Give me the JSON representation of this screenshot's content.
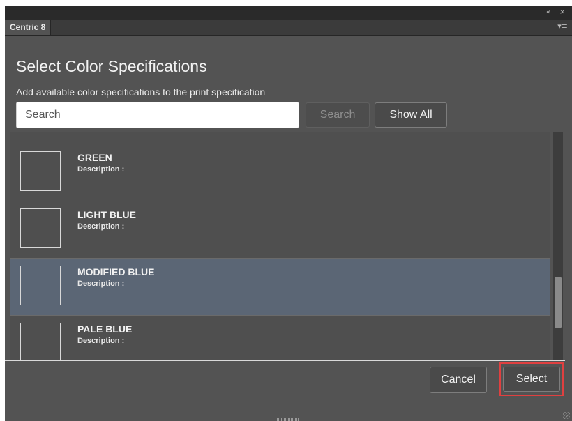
{
  "window": {
    "collapse_icon": "double-chevron-left-icon",
    "collapse_glyph": "«",
    "close_icon": "close-icon",
    "close_glyph": "×",
    "accent_color": "#4a90c2"
  },
  "tab_bar": {
    "tab_label": "Centric 8",
    "menu_icon": "panel-menu-icon",
    "menu_glyph": "▾≡"
  },
  "dialog": {
    "title": "Select Color Specifications",
    "subtitle": "Add available color specifications to the print specification"
  },
  "search": {
    "placeholder": "Search",
    "value": "",
    "search_button_label": "Search",
    "show_all_button_label": "Show All"
  },
  "list": {
    "items": [
      {
        "name": "GREEN",
        "description": "Description :",
        "selected": false
      },
      {
        "name": "LIGHT BLUE",
        "description": "Description :",
        "selected": false
      },
      {
        "name": "MODIFIED BLUE",
        "description": "Description :",
        "selected": true
      },
      {
        "name": "PALE BLUE",
        "description": "Description :",
        "selected": false
      }
    ],
    "selected_color": "#5b6675"
  },
  "footer": {
    "cancel_label": "Cancel",
    "select_label": "Select",
    "highlight_color": "#e04040"
  }
}
